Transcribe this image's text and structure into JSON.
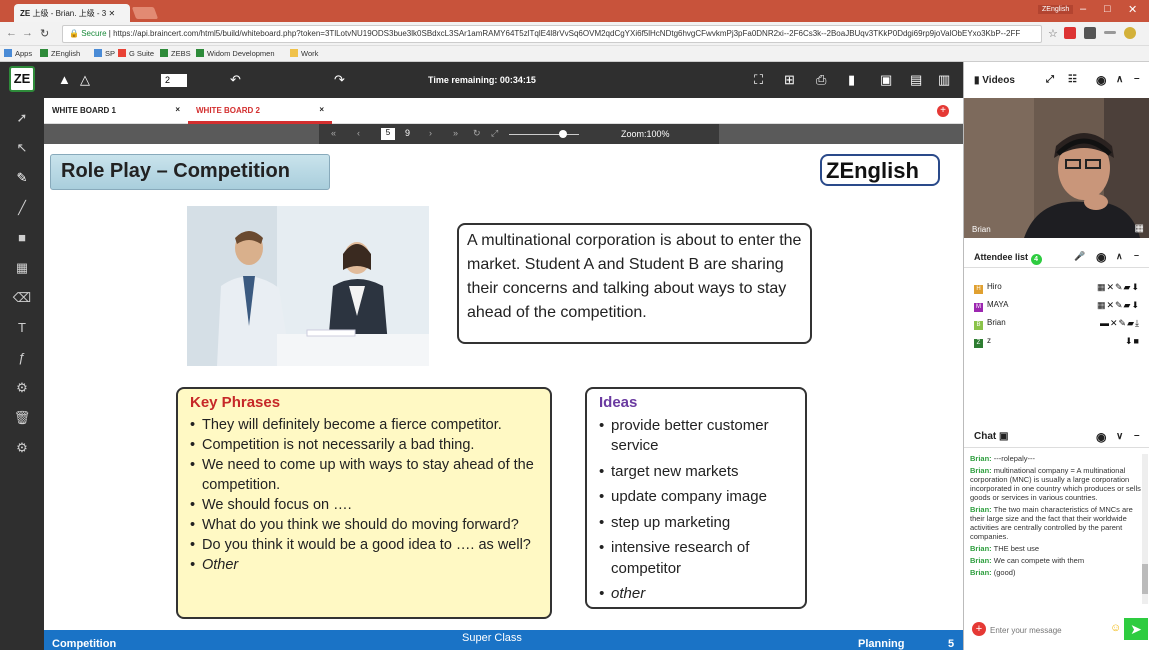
{
  "browser": {
    "tab_title": "上级 - Brian. 上级 - 3",
    "tab_logo": "ZE",
    "window_label": "ZEnglish",
    "secure_label": "Secure",
    "url": "https://api.braincert.com/html5/build/whiteboard.php?token=3TlLotvNU19ODS3bue3lk0SBdxcL3SAr1amRAMY64T5zlTqlE4l8rVvSq6OVM2qdCgYXi6f5lHcNDtg6hvgCFwvkmPj3pFa0DNR2xi--2F6Cs3k--2BoaJBUqv3TKkP0Ddgi69rp9joValObEYxo3KbP--2FF",
    "bookmarks": [
      "Apps",
      "ZEnglish",
      "SP",
      "G Suite",
      "ZEBS",
      "Widom Developmen",
      "Work"
    ]
  },
  "toolbar": {
    "page_count_input": "2",
    "timer": "Time remaining: 00:34:15"
  },
  "whiteboard_tabs": [
    {
      "label": "WHITE BOARD 1",
      "close": "×"
    },
    {
      "label": "WHITE BOARD 2",
      "close": "×"
    }
  ],
  "pager": {
    "current_page": "5",
    "total_pages": "9",
    "zoom": "Zoom:100%"
  },
  "slide": {
    "title": "Role Play – Competition",
    "brand": "ZEnglish",
    "description": "A multinational corporation is about to enter the market. Student A and Student B are sharing their concerns and talking about ways to stay ahead of the competition.",
    "key_phrases_heading": "Key Phrases",
    "key_phrases": [
      "They will definitely become a fierce competitor.",
      "Competition is not necessarily a bad thing.",
      "We need to come up with ways to stay ahead of the competition.",
      "We should focus on ….",
      "What do you think we should do moving forward?",
      "Do you think it would be a good idea to …. as well?",
      "Other"
    ],
    "ideas_heading": "Ideas",
    "ideas": [
      "provide better customer service",
      "target new markets",
      "update company image",
      "step up marketing",
      "intensive research of competitor",
      "other"
    ]
  },
  "footer": {
    "left": "Competition",
    "center": "Super Class",
    "right": "Planning",
    "page": "5"
  },
  "videos": {
    "header": "Videos",
    "participant_name": "Brian"
  },
  "attendees": {
    "header": "Attendee list",
    "count": "4",
    "list": [
      {
        "initial": "H",
        "name": "Hiro",
        "color": "#e0a030"
      },
      {
        "initial": "M",
        "name": "MAYA",
        "color": "#9c27b0"
      },
      {
        "initial": "B",
        "name": "Brian",
        "color": "#8bc34a"
      },
      {
        "initial": "Z",
        "name": "z",
        "color": "#2e7d32"
      }
    ]
  },
  "chat": {
    "header": "Chat",
    "messages": [
      {
        "from": "Brian:",
        "text": "---rolepaly---"
      },
      {
        "from": "Brian:",
        "text": "multinational company = A multinational corporation (MNC) is usually a large corporation incorporated in one country which produces or sells goods or services in various countries."
      },
      {
        "from": "Brian:",
        "text": "The two main characteristics of MNCs are their large size and the fact that their worldwide activities are centrally controlled by the parent companies."
      },
      {
        "from": "Brian:",
        "text": "THE best use"
      },
      {
        "from": "Brian:",
        "text": "We can compete with them"
      },
      {
        "from": "Brian:",
        "text": "(good)"
      }
    ],
    "placeholder": "Enter your message"
  }
}
